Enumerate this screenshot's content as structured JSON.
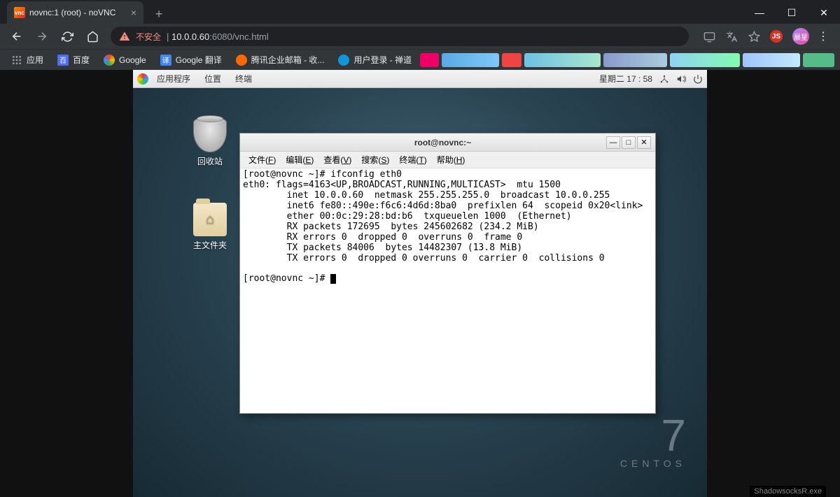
{
  "chrome": {
    "tab": {
      "favicon": "vnc",
      "title": "novnc:1 (root) - noVNC"
    },
    "nav": {
      "warn": "不安全",
      "url_host": "10.0.0.60",
      "url_path": ":6080/vnc.html"
    },
    "avatar": "晨星",
    "bookmarks": {
      "apps": "应用",
      "items": [
        {
          "label": "百度",
          "color": "#4e6ef2"
        },
        {
          "label": "Google",
          "color": "#fff"
        },
        {
          "label": "Google 翻译",
          "color": "#4285f4"
        },
        {
          "label": "腾讯企业邮箱 - 收...",
          "color": "#07c160"
        },
        {
          "label": "用户登录 - 禅道",
          "color": "#1296db"
        }
      ]
    }
  },
  "panel": {
    "apps": "应用程序",
    "places": "位置",
    "terminal": "终端",
    "clock": "星期二 17 : 58"
  },
  "desktop": {
    "trash": "回收站",
    "home": "主文件夹",
    "brand_num": "7",
    "brand_txt": "CENTOS"
  },
  "terminal": {
    "title": "root@novnc:~",
    "menus": {
      "file": "文件(F)",
      "edit": "编辑(E)",
      "view": "查看(V)",
      "search": "搜索(S)",
      "term": "终端(T)",
      "help": "帮助(H)"
    },
    "lines": [
      "[root@novnc ~]# ifconfig eth0",
      "eth0: flags=4163<UP,BROADCAST,RUNNING,MULTICAST>  mtu 1500",
      "        inet 10.0.0.60  netmask 255.255.255.0  broadcast 10.0.0.255",
      "        inet6 fe80::490e:f6c6:4d6d:8ba0  prefixlen 64  scopeid 0x20<link>",
      "        ether 00:0c:29:28:bd:b6  txqueuelen 1000  (Ethernet)",
      "        RX packets 172695  bytes 245602682 (234.2 MiB)",
      "        RX errors 0  dropped 0  overruns 0  frame 0",
      "        TX packets 84006  bytes 14482307 (13.8 MiB)",
      "        TX errors 0  dropped 0 overruns 0  carrier 0  collisions 0",
      "",
      "[root@novnc ~]# "
    ]
  },
  "statusbar": "ShadowsocksR.exe"
}
